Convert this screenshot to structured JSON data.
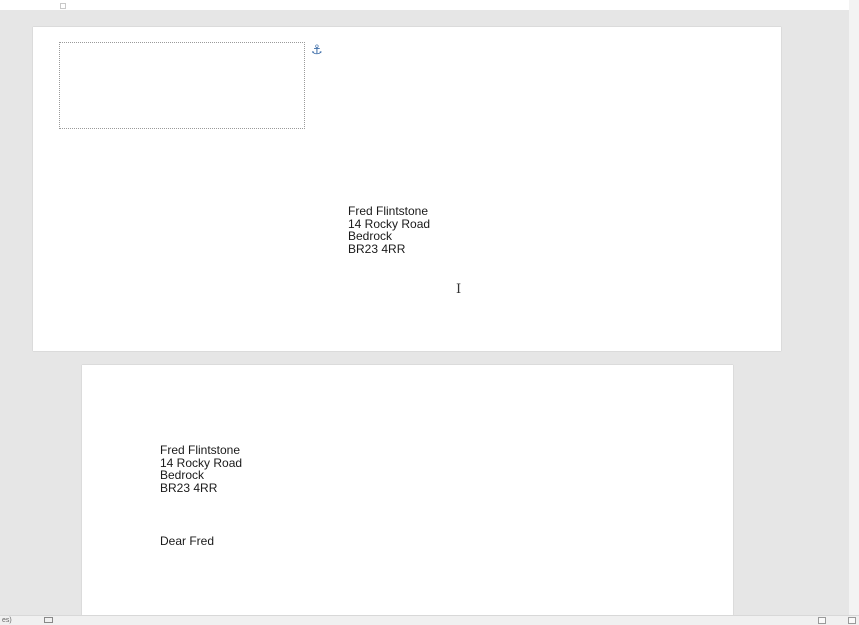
{
  "envelope": {
    "address": [
      "Fred Flintstone",
      "14 Rocky Road",
      "Bedrock",
      "BR23 4RR"
    ],
    "anchor_icon": "anchor-icon"
  },
  "letter": {
    "address": [
      "Fred Flintstone",
      "14 Rocky Road",
      "Bedrock",
      "BR23 4RR"
    ],
    "greeting": "Dear Fred"
  },
  "statusbar": {
    "left_text": "es)"
  },
  "icons": {
    "cursor": "text-cursor-icon",
    "macro": "macro-recording-icon",
    "read_mode": "read-mode-icon",
    "print_layout": "print-layout-icon"
  }
}
